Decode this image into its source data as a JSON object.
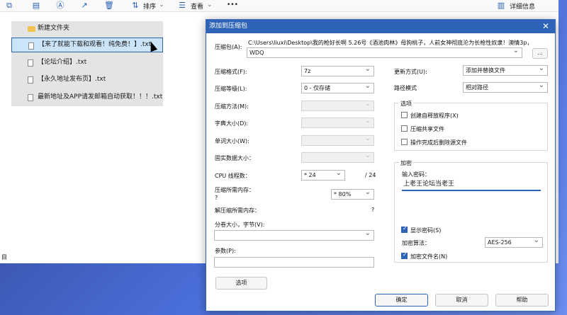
{
  "toolbar": {
    "sort_label": "排序",
    "view_label": "查看",
    "more_label": "•••",
    "details_label": "详细信息"
  },
  "files": [
    {
      "name": "新建文件夹",
      "type": "folder"
    },
    {
      "name": "【来了就能下载和观看！纯免费！】.txt",
      "type": "file"
    },
    {
      "name": "【论坛介绍】.txt",
      "type": "file"
    },
    {
      "name": "【永久地址发布页】.txt",
      "type": "file"
    },
    {
      "name": "最新地址及APP请发邮箱自动获取！！！.txt",
      "type": "file"
    }
  ],
  "status_text": "目",
  "dialog": {
    "title": "添加到压缩包",
    "archive_label": "压缩包(A):",
    "archive_path": "C:\\Users\\liuxi\\Desktop\\我的枪好长啊 5.26号《酒池肉林》母狗桃子，人前女神彻底沦为长枪性奴隶！澳情3p，",
    "archive_value": "WDQ",
    "browse_label": "...",
    "format_label": "压缩格式(F):",
    "format_value": "7z",
    "level_label": "压缩等级(L):",
    "level_value": "0 - 仅存储",
    "method_label": "压缩方法(M):",
    "dict_label": "字典大小(D):",
    "word_label": "单词大小(W):",
    "solid_label": "固实数据大小：",
    "cpu_label": "CPU 线程数：",
    "cpu_value": "* 24",
    "cpu_total": "/ 24",
    "mem_label": "压缩所需内存：",
    "mem_q": "?",
    "mem_value": "* 80%",
    "decomp_label": "解压缩所需内存：",
    "decomp_q": "?",
    "split_label": "分卷大小，字节(V):",
    "params_label": "参数(P):",
    "options_button": "选项",
    "update_label": "更新方式(U):",
    "update_value": "添加并替换文件",
    "path_label": "路径模式",
    "path_value": "相对路径",
    "options_group": "选项",
    "opt_sfx": "创建自释放程序(X)",
    "opt_shared": "压缩共享文件",
    "opt_delete": "操作完成后删除源文件",
    "encrypt_group": "加密",
    "pwd_label": "输入密码：",
    "pwd_value": "上老王论坛当老王",
    "show_pwd": "显示密码(S)",
    "enc_method_label": "加密算法：",
    "enc_method_value": "AES-256",
    "enc_names": "加密文件名(N)",
    "ok": "确定",
    "cancel": "取消",
    "help": "帮助"
  }
}
